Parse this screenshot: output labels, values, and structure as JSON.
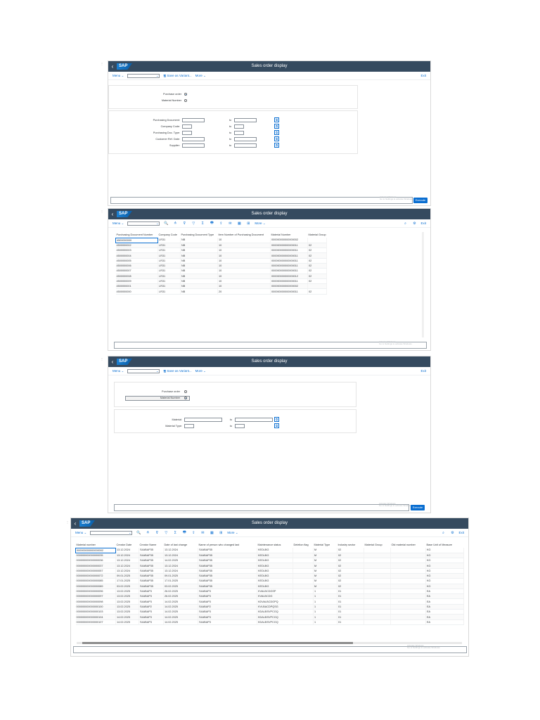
{
  "title": "Sales order display",
  "logo": "SAP",
  "toolbar": {
    "menu": "Menu",
    "save_variant": "Save as Variant...",
    "more": "More",
    "exit": "Exit"
  },
  "icons": {
    "back": "‹",
    "chevron": "⌄",
    "save": "🖫",
    "search": "⌕",
    "settings": "⚙",
    "select": "⧉",
    "find": "🔍",
    "sort_asc": "≙",
    "sort_desc": "⊽",
    "filter": "▽",
    "sum": "Σ",
    "print": "🖶",
    "export": "⇪",
    "mail": "✉",
    "layout": "▦",
    "grid": "⊞"
  },
  "screen1": {
    "radio_purchase": "Purchase order",
    "radio_material": "Material Number",
    "fields": [
      {
        "label": "Purchasing Document:",
        "to": "to"
      },
      {
        "label": "Company Code:",
        "to": "to"
      },
      {
        "label": "Purchasing Doc. Type:",
        "to": "to"
      },
      {
        "label": "Customer Ref. Date:",
        "to": "to"
      },
      {
        "label": "Supplier:",
        "to": "to"
      }
    ],
    "watermark_1": "Activate Windows",
    "watermark_2": "Go to Settings to activate Windows.",
    "execute": "Execute"
  },
  "screen2": {
    "headers": [
      "Purchasing Document Number",
      "Company Code",
      "Purchasing Document Type",
      "Item Number of Purchasing Document",
      "Material Number",
      "Material Group"
    ],
    "rows": [
      [
        "4500000000",
        "LR31",
        "NB",
        "10",
        "000000000000000002",
        ""
      ],
      [
        "4500000002",
        "LR31",
        "NB",
        "10",
        "000000000000000011",
        "02"
      ],
      [
        "4500000003",
        "LR31",
        "NB",
        "10",
        "000000000000000011",
        "02"
      ],
      [
        "4500000004",
        "LR31",
        "NB",
        "10",
        "000000000000000011",
        "02"
      ],
      [
        "4500000005",
        "LR31",
        "NB",
        "10",
        "000000000000000011",
        "02"
      ],
      [
        "4500000006",
        "LR31",
        "NB",
        "10",
        "000000000000000011",
        "02"
      ],
      [
        "4500000007",
        "LR31",
        "NB",
        "10",
        "000000000000000011",
        "02"
      ],
      [
        "4500000008",
        "LR31",
        "NB",
        "10",
        "000000000000000012",
        "02"
      ],
      [
        "4500000009",
        "LR31",
        "NB",
        "10",
        "000000000000000011",
        "02"
      ],
      [
        "4500000001",
        "LR31",
        "NB",
        "10",
        "000000000000000002",
        ""
      ],
      [
        "4500000000",
        "LR31",
        "NB",
        "20",
        "000000000000000011",
        "02"
      ]
    ],
    "watermark_1": "Activate Windows",
    "watermark_2": "Go to Settings to activate Windows."
  },
  "screen3": {
    "radio_purchase": "Purchase order",
    "radio_material": "Material Number",
    "fields": [
      {
        "label": "Material:",
        "to": "to"
      },
      {
        "label": "Material Type:",
        "to": "to"
      }
    ],
    "watermark_1": "Activate Windows",
    "watermark_2": "Go to Settings to activate Windows.",
    "execute": "Execute"
  },
  "screen4": {
    "headers": [
      "Material number",
      "Creator Date",
      "Creator Name",
      "Date of last change",
      "Name of person who changed last",
      "Maintenance status",
      "Deletion flag",
      "Material Type",
      "Industry sector",
      "Material Group",
      "Old material number",
      "Base Unit of Measure"
    ],
    "rows": [
      [
        "000000000000000002",
        "13.12.2024",
        "S4ABAP35",
        "13.12.2024",
        "S4ABAP35",
        "KEDLBG",
        "",
        "M",
        "02",
        "",
        "",
        "KG"
      ],
      [
        "000000000000000035",
        "13.12.2024",
        "S4ABAP35",
        "13.12.2024",
        "S4ABAP35",
        "KEDLBG",
        "",
        "M",
        "02",
        "",
        "",
        "KG"
      ],
      [
        "000000000000000036",
        "13.12.2024",
        "S4ABAP35",
        "14.02.2025",
        "S4ABAP35",
        "KEDLBG",
        "",
        "M",
        "02",
        "",
        "",
        "KG"
      ],
      [
        "000000000000000037",
        "13.12.2024",
        "S4ABAP35",
        "13.12.2024",
        "S4ABAP35",
        "KEDLBG",
        "",
        "M",
        "02",
        "",
        "",
        "KG"
      ],
      [
        "000000000000000057",
        "13.12.2024",
        "S4ABAP35",
        "13.12.2024",
        "S4ABAP35",
        "KEDLBG",
        "",
        "M",
        "02",
        "",
        "",
        "KG"
      ],
      [
        "000000000000000072",
        "09.01.2025",
        "S4ABAP35",
        "09.01.2025",
        "S4ABAP35",
        "KEDLBG",
        "",
        "M",
        "02",
        "",
        "",
        "KG"
      ],
      [
        "000000000000000085",
        "17.01.2025",
        "S4ABAP35",
        "17.01.2025",
        "S4ABAP35",
        "KEDLBG",
        "",
        "M",
        "02",
        "",
        "",
        "KG"
      ],
      [
        "000000000000000089",
        "03.02.2025",
        "S4ABAP35",
        "03.02.2025",
        "S4ABAP35",
        "KEDLBG",
        "",
        "M",
        "02",
        "",
        "",
        "KG"
      ],
      [
        "000000000000000096",
        "13.02.2025",
        "S4ABAP3",
        "26.02.2025",
        "S4ABAP3",
        "KVALBCDGSP",
        "",
        "1",
        "01",
        "",
        "",
        "EA"
      ],
      [
        "000000000000000097",
        "13.02.2025",
        "S4ABAP3",
        "26.02.2025",
        "S4ABAP3",
        "KVALBCDG",
        "",
        "1",
        "01",
        "",
        "",
        "EA"
      ],
      [
        "000000000000000098",
        "13.02.2025",
        "S4ABAP3",
        "14.02.2025",
        "S4ABAP3",
        "KDVALBCDGPQ",
        "",
        "1",
        "01",
        "",
        "",
        "EA"
      ],
      [
        "000000000000000100",
        "13.02.2025",
        "S4ABAP2",
        "14.02.2025",
        "S4ABAP2",
        "KVLBACDPQSG",
        "",
        "1",
        "01",
        "",
        "",
        "EA"
      ],
      [
        "000000000000000103",
        "13.02.2025",
        "S4ABAP3",
        "14.02.2025",
        "S4ABAP3",
        "KDALBSVPCGQ",
        "",
        "1",
        "01",
        "",
        "",
        "EA"
      ],
      [
        "000000000000000104",
        "14.02.2025",
        "S4ABAP3",
        "14.02.2025",
        "S4ABAP3",
        "KDALBSVPCGQ",
        "",
        "1",
        "01",
        "",
        "",
        "EA"
      ],
      [
        "000000000000000107",
        "14.02.2025",
        "S4ABAP3",
        "14.02.2025",
        "S4ABAP3",
        "KDALBSVPCGQ",
        "",
        "1",
        "01",
        "",
        "",
        "EA"
      ]
    ],
    "watermark_1": "Activate Windows",
    "watermark_2": "Go to Settings to activate Windows."
  }
}
